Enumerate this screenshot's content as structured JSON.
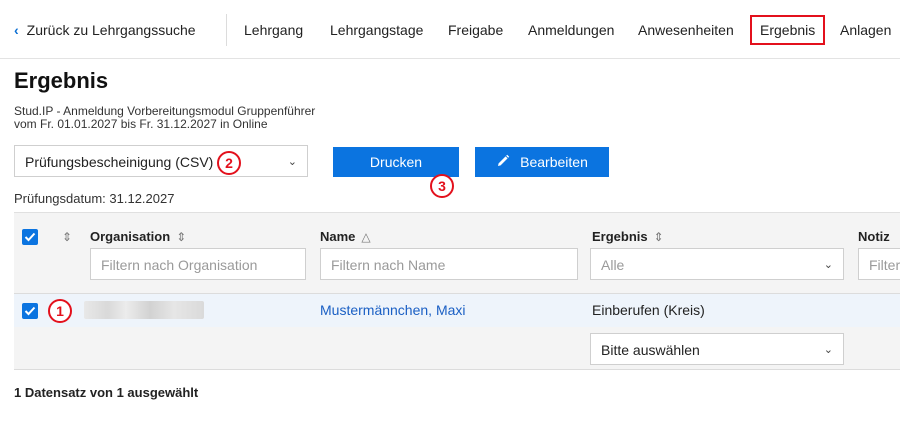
{
  "nav": {
    "back_label": "Zurück zu Lehrgangssuche",
    "tabs": [
      {
        "label": "Lehrgang"
      },
      {
        "label": "Lehrgangstage"
      },
      {
        "label": "Freigabe"
      },
      {
        "label": "Anmeldungen"
      },
      {
        "label": "Anwesenheiten"
      },
      {
        "label": "Ergebnis",
        "active": true
      },
      {
        "label": "Anlagen"
      }
    ]
  },
  "page": {
    "title": "Ergebnis",
    "subtitle_line1": "Stud.IP - Anmeldung Vorbereitungsmodul Gruppenführer",
    "subtitle_line2": "vom Fr. 01.01.2027 bis Fr. 31.12.2027 in Online",
    "exam_date": "Prüfungsdatum: 31.12.2027"
  },
  "toolbar": {
    "export_select_value": "Prüfungsbescheinigung (CSV)",
    "print_label": "Drucken",
    "edit_label": "Bearbeiten"
  },
  "annotations": {
    "one": "1",
    "two": "2",
    "three": "3"
  },
  "table": {
    "headers": {
      "organisation": "Organisation",
      "name": "Name",
      "ergebnis": "Ergebnis",
      "notiz": "Notiz"
    },
    "filters": {
      "organisation_placeholder": "Filtern nach Organisation",
      "name_placeholder": "Filtern nach Name",
      "ergebnis_value": "Alle",
      "notiz_placeholder": "Filter"
    },
    "rows": [
      {
        "name": "Mustermännchen, Maxi",
        "ergebnis": "Einberufen (Kreis)",
        "select_value": "Bitte auswählen"
      }
    ]
  },
  "footer": {
    "selection_text": "1 Datensatz von 1 ausgewählt"
  },
  "colors": {
    "accent": "#0b74e0",
    "annotation": "#e3101c",
    "link": "#1a5fc4"
  }
}
